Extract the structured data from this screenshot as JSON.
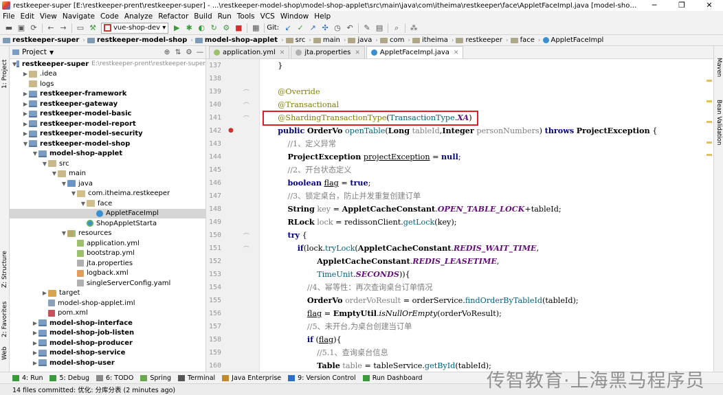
{
  "window": {
    "title": "restkeeper-super [E:\\restkeeper-prent\\restkeeper-super] - ...\\restkeeper-model-shop\\model-shop-applet\\src\\main\\java\\com\\itheima\\restkeeper\\face\\AppletFaceImpl.java [model-shop-applet] - IntelliJ IDEA",
    "minimize": "─",
    "restore": "❐",
    "close": "✕"
  },
  "menu": [
    "File",
    "Edit",
    "View",
    "Navigate",
    "Code",
    "Analyze",
    "Refactor",
    "Build",
    "Run",
    "Tools",
    "VCS",
    "Window",
    "Help"
  ],
  "toolbar": {
    "run_config": "vue-shop-dev",
    "git_label": "Git:"
  },
  "breadcrumbs": [
    "restkeeper-super",
    "restkeeper-model-shop",
    "model-shop-applet",
    "src",
    "main",
    "java",
    "com",
    "itheima",
    "restkeeper",
    "face",
    "AppletFaceImpl"
  ],
  "project": {
    "header": "Project",
    "tree": [
      {
        "label": "restkeeper-super",
        "path": "E:\\restkeeper-prent\\restkeeper-super",
        "indent": 0,
        "tw": "▼",
        "icon": "mod",
        "bold": true
      },
      {
        "label": ".idea",
        "indent": 1,
        "tw": "▶",
        "icon": "folder"
      },
      {
        "label": "logs",
        "indent": 1,
        "tw": "",
        "icon": "folder"
      },
      {
        "label": "restkeeper-framework",
        "indent": 1,
        "tw": "▶",
        "icon": "mod",
        "bold": true
      },
      {
        "label": "restkeeper-gateway",
        "indent": 1,
        "tw": "▶",
        "icon": "mod",
        "bold": true
      },
      {
        "label": "restkeeper-model-basic",
        "indent": 1,
        "tw": "▶",
        "icon": "mod",
        "bold": true
      },
      {
        "label": "restkeeper-model-report",
        "indent": 1,
        "tw": "▶",
        "icon": "mod",
        "bold": true
      },
      {
        "label": "restkeeper-model-security",
        "indent": 1,
        "tw": "▶",
        "icon": "mod",
        "bold": true
      },
      {
        "label": "restkeeper-model-shop",
        "indent": 1,
        "tw": "▼",
        "icon": "mod",
        "bold": true
      },
      {
        "label": "model-shop-applet",
        "indent": 2,
        "tw": "▼",
        "icon": "mod",
        "bold": true
      },
      {
        "label": "src",
        "indent": 3,
        "tw": "▼",
        "icon": "folder"
      },
      {
        "label": "main",
        "indent": 4,
        "tw": "▼",
        "icon": "folder"
      },
      {
        "label": "java",
        "indent": 5,
        "tw": "▼",
        "icon": "src"
      },
      {
        "label": "com.itheima.restkeeper",
        "indent": 6,
        "tw": "▼",
        "icon": "pkg"
      },
      {
        "label": "face",
        "indent": 7,
        "tw": "▼",
        "icon": "pkg"
      },
      {
        "label": "AppletFaceImpl",
        "indent": 8,
        "tw": "",
        "icon": "cls",
        "selected": true
      },
      {
        "label": "ShopAppletStarta",
        "indent": 7,
        "tw": "",
        "icon": "clsg"
      },
      {
        "label": "resources",
        "indent": 5,
        "tw": "▼",
        "icon": "res"
      },
      {
        "label": "application.yml",
        "indent": 6,
        "tw": "",
        "icon": "yml"
      },
      {
        "label": "bootstrap.yml",
        "indent": 6,
        "tw": "",
        "icon": "yml"
      },
      {
        "label": "jta.properties",
        "indent": 6,
        "tw": "",
        "icon": "prop"
      },
      {
        "label": "logback.xml",
        "indent": 6,
        "tw": "",
        "icon": "xml"
      },
      {
        "label": "singleServerConfig.yaml",
        "indent": 6,
        "tw": "",
        "icon": "prop"
      },
      {
        "label": "target",
        "indent": 3,
        "tw": "▶",
        "icon": "tgt"
      },
      {
        "label": "model-shop-applet.iml",
        "indent": 3,
        "tw": "",
        "icon": "iml"
      },
      {
        "label": "pom.xml",
        "indent": 3,
        "tw": "",
        "icon": "pom"
      },
      {
        "label": "model-shop-interface",
        "indent": 2,
        "tw": "▶",
        "icon": "mod",
        "bold": true
      },
      {
        "label": "model-shop-job-listen",
        "indent": 2,
        "tw": "▶",
        "icon": "mod",
        "bold": true
      },
      {
        "label": "model-shop-producer",
        "indent": 2,
        "tw": "▶",
        "icon": "mod",
        "bold": true
      },
      {
        "label": "model-shop-service",
        "indent": 2,
        "tw": "▶",
        "icon": "mod",
        "bold": true
      },
      {
        "label": "model-shop-user",
        "indent": 2,
        "tw": "▶",
        "icon": "mod",
        "bold": true
      }
    ]
  },
  "editor_tabs": [
    {
      "label": "application.yml",
      "active": false,
      "color": "#9bc26a"
    },
    {
      "label": "jta.properties",
      "active": false,
      "color": "#b0b0b0"
    },
    {
      "label": "AppletFaceImpl.java",
      "active": true,
      "color": "#3a8fd1"
    }
  ],
  "code_lines": [
    {
      "n": "137",
      "html": "    <span class=\"par\">}</span>"
    },
    {
      "n": "138",
      "html": ""
    },
    {
      "n": "139",
      "html": "    <span class=\"ann\">@Override</span>"
    },
    {
      "n": "140",
      "html": "    <span class=\"ann\">@Transactional</span>"
    },
    {
      "n": "141",
      "html": "    <span class=\"ann\">@ShardingTransactionType</span>(<span class=\"fn\">TransactionType</span>.<span class=\"cst\">XA</span>)"
    },
    {
      "n": "142",
      "html": "    <span class=\"kw\">public</span> <b>OrderVo</b> <span class=\"fn\">openTable</span>(<b>Long</b> <span class=\"cm\">tableId</span>,<b>Integer</b> <span class=\"cm\">personNumbers</span>) <span class=\"kw\">throws</span> <b>ProjectException</b> {"
    },
    {
      "n": "143",
      "html": "        <span class=\"cm\">//1、定义异常</span>"
    },
    {
      "n": "144",
      "html": "        <b>ProjectException</b> <u>projectException</u> = <span class=\"kw\">null</span>;"
    },
    {
      "n": "145",
      "html": "        <span class=\"cm\">//2、开台状态定义</span>"
    },
    {
      "n": "146",
      "html": "        <span class=\"kw\">boolean</span> <u>flag</u> = <span class=\"kw\">true</span>;"
    },
    {
      "n": "147",
      "html": "        <span class=\"cm\">//3、锁定桌台，防止并发重复创建订单</span>"
    },
    {
      "n": "148",
      "html": "        <b>String</b> <span class=\"cm\">key</span> = <b>AppletCacheConstant</b>.<span class=\"cst\">OPEN_TABLE_LOCK</span>+tableId;"
    },
    {
      "n": "149",
      "html": "        <b>RLock</b> <span class=\"cm\">lock</span> = redissonClient.<span class=\"fn\">getLock</span>(key);"
    },
    {
      "n": "150",
      "html": "        <span class=\"kw\">try</span> {"
    },
    {
      "n": "151",
      "html": "            <span class=\"kw\">if</span>(lock.<span class=\"fn\">tryLock</span>(<b>AppletCacheConstant</b>.<span class=\"cst\">REDIS_WAIT_TIME</span>,"
    },
    {
      "n": "152",
      "html": "                    <b>AppletCacheConstant</b>.<span class=\"cst\">REDIS_LEASETIME</span>,"
    },
    {
      "n": "153",
      "html": "                    <span class=\"fn\">TimeUnit</span>.<span class=\"cst\">SECONDS</span>)){"
    },
    {
      "n": "154",
      "html": "                <span class=\"cm\">//4、幂等性：再次查询桌台订单情况</span>"
    },
    {
      "n": "155",
      "html": "                <b>OrderVo</b> <span class=\"cm\">orderVoResult</span> = orderService.<span class=\"fn\">findOrderByTableId</span>(tableId);"
    },
    {
      "n": "156",
      "html": "                <u>flag</u> = <b>EmptyUtil</b>.<i>isNullOrEmpty</i>(orderVoResult);"
    },
    {
      "n": "157",
      "html": "                <span class=\"cm\">//5、未开台,为桌台创建当订单</span>"
    },
    {
      "n": "158",
      "html": "                <span class=\"kw\">if</span> (<u>flag</u>){"
    },
    {
      "n": "159",
      "html": "                    <span class=\"cm\">//5.1、查询桌台信息</span>"
    },
    {
      "n": "160",
      "html": "                    <b>Table</b> <span class=\"cm\">table</span> = tableService.<span class=\"fn\">getById</span>(tableId);"
    }
  ],
  "left_tools": [
    "1: Project",
    "Z: Structure",
    "2: Favorites",
    "Web"
  ],
  "right_tools": [
    "Maven",
    "Bean Validation"
  ],
  "bottom_tools": [
    "4: Run",
    "5: Debug",
    "6: TODO",
    "Spring",
    "Terminal",
    "Java Enterprise",
    "9: Version Control",
    "Run Dashboard"
  ],
  "status": {
    "message": "14 files committed: 优化: 分库分表 (2 minutes ago)"
  },
  "watermark": "传智教育·上海黑马程序员",
  "colors": {
    "accent": "#3a8fd1",
    "highlight_box": "#e02020"
  }
}
